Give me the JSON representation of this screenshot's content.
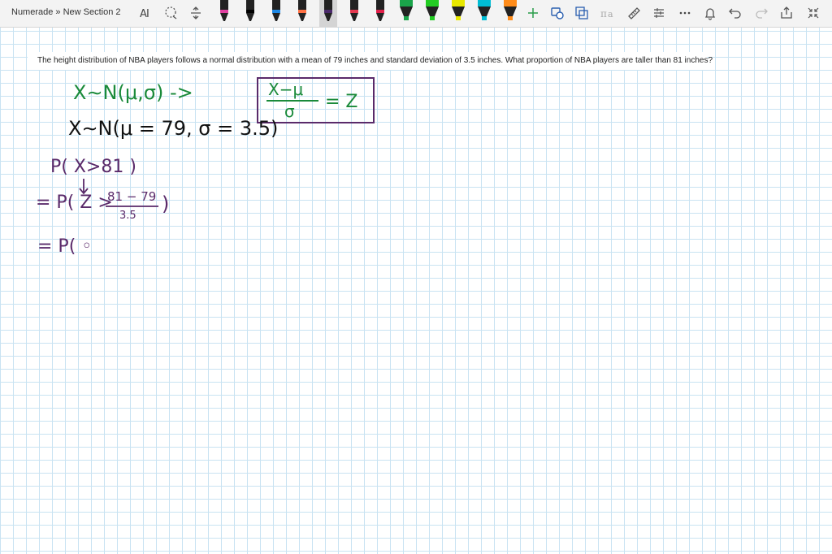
{
  "breadcrumb": "Numerade » New Section 2",
  "toolbar": {
    "icons": [
      "text-select-icon",
      "lasso-icon",
      "insert-space-icon",
      "plus-icon",
      "shape-icon",
      "ink-to-shape-icon",
      "ink-to-math-icon",
      "ruler-icon",
      "settings-icon",
      "more-icon",
      "bell-icon",
      "undo-icon",
      "redo-icon",
      "share-icon",
      "collapse-icon"
    ],
    "pen_colors": [
      "#e040a0",
      "#000000",
      "#1e88e5",
      "#ff7043",
      "#4b2a6b",
      "#e53950",
      "#e0204a",
      "#1aa34a",
      "#22cc22",
      "#e8e800",
      "#00bcd4",
      "#ff8c1a"
    ],
    "selected_pen_index": 4
  },
  "question": "The height distribution of NBA players follows a normal distribution with a mean of 79 inches and standard deviation of 3.5 inches. What proportion of NBA players are taller than 81 inches?",
  "handwriting": {
    "ink_green": "#1a8a3a",
    "ink_black": "#111111",
    "ink_purple": "#5a2a6a",
    "ink_blue": "#2a5fb0",
    "line1": "X∼N(μ,σ) ->",
    "boxed_num": "X−μ",
    "boxed_den": "σ",
    "boxed_rhs": "= Z",
    "line2": "X∼N(μ = 79, σ = 3.5)",
    "line3": "P( X>81 )",
    "line4_lhs": "= P( Z >",
    "line4_num": "81 − 79",
    "line4_den": "3.5",
    "line4_close": ")",
    "line5": "= P( ◦"
  }
}
